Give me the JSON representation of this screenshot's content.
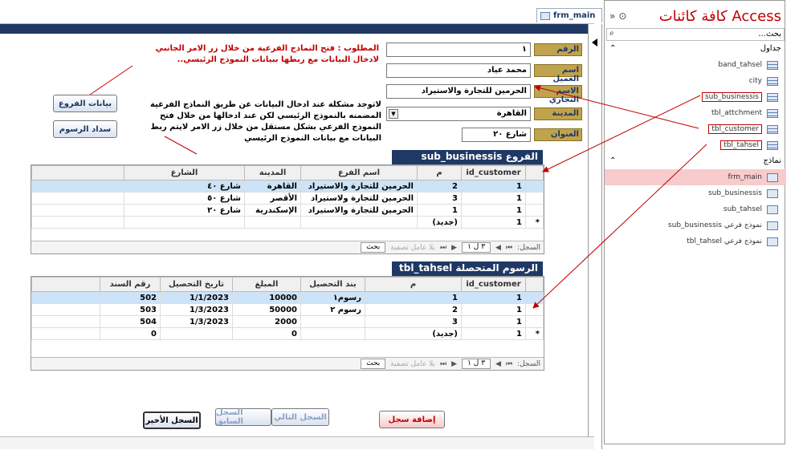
{
  "tab": {
    "label": "frm_main"
  },
  "main_form": {
    "fields": [
      {
        "label": "الرقم",
        "value": "١"
      },
      {
        "label": "اسم العميل",
        "value": "محمد عياد"
      },
      {
        "label": "الاسم التجاري",
        "value": "الحرمين للتجارة والاستيراد"
      },
      {
        "label": "المدينة",
        "value": "القاهرة"
      },
      {
        "label": "العنوان",
        "value": "شارع ٢٠"
      }
    ],
    "note_red": "المطلوب : فتح النماذج الفرعية من خلال زر الامر الجانبي لادخال البيانات مع ربطها ببيانات النموذج الرئيسي..",
    "note_black": "لاتوجد مشكلة عند ادخال البيانات عن طريق النماذج الفرعية المضمنه بالنموذج الرئيسي لكن عند ادخالها من خلال فتح النموذج الفرعي بشكل مستقل من خلال زر الامر لايتم ربط البيانات مع بيانات النموذج الرئيسي",
    "btn_branches": "بيانات الفروع",
    "btn_fees": "سداد الرسوم"
  },
  "sub_businessis": {
    "title": "الفروع sub_businessis",
    "columns": [
      "id_customer",
      "م",
      "اسم الفرع",
      "المدينة",
      "الشارع"
    ],
    "rows": [
      [
        "1",
        "2",
        "الحرمين للتجارة والاستيراد",
        "القاهرة",
        "شارع ٤٠"
      ],
      [
        "1",
        "3",
        "الحرمين للتجارة ولاستيراد",
        "الأقصر",
        "شارع ٥٠"
      ],
      [
        "1",
        "1",
        "الحرمين للتجارة والاستيراد",
        "الإسكندرية",
        "شارع ٢٠"
      ],
      [
        "1",
        "(جديد)",
        "",
        "",
        ""
      ]
    ],
    "nav": {
      "record_label": "السجل:",
      "record_value": "٣ ل ١",
      "filter": "بلا عامل تصفية",
      "search": "بحث"
    }
  },
  "tbl_tahsel": {
    "title": "الرسوم المتحصلة tbl_tahsel",
    "columns": [
      "id_customer",
      "م",
      "بند التحصيل",
      "المبلغ",
      "تاريخ التحصيل",
      "رقم السند"
    ],
    "rows": [
      [
        "1",
        "1",
        "رسوم١",
        "10000",
        "1/1/2023",
        "502"
      ],
      [
        "1",
        "2",
        "رسوم ٢",
        "50000",
        "1/3/2023",
        "503"
      ],
      [
        "1",
        "3",
        "",
        "2000",
        "1/3/2023",
        "504"
      ],
      [
        "1",
        "(جديد)",
        "",
        "0",
        "",
        "0"
      ]
    ],
    "nav": {
      "record_label": "السجل:",
      "record_value": "٣ ل ١",
      "filter": "بلا عامل تصفية",
      "search": "بحث"
    }
  },
  "bottom_buttons": {
    "add": "إضافة سجل",
    "next": "السجل التالي",
    "prev": "السجل السابق",
    "last": "السجل الأخير"
  },
  "nav_pane": {
    "title": "كافة كائنات Access",
    "search_placeholder": "بحث...",
    "tables_group": "جداول",
    "tables": [
      "band_tahsel",
      "city",
      "sub_businessis",
      "tbl_attchment",
      "tbl_customer",
      "tbl_tahsel"
    ],
    "forms_group": "نماذج",
    "forms": [
      "frm_main",
      "sub_businessis",
      "sub_tahsel",
      "نموذج فرعي sub_businessis",
      "نموذج فرعي tbl_tahsel"
    ]
  }
}
